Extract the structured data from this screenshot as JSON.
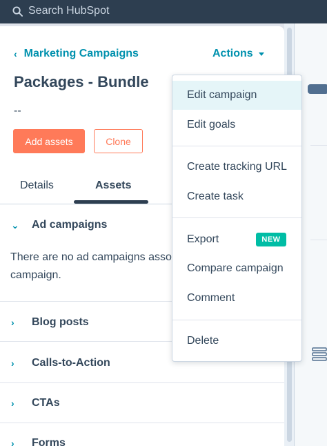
{
  "search": {
    "placeholder": "Search HubSpot",
    "icon": "search-icon"
  },
  "breadcrumb": {
    "label": "Marketing Campaigns"
  },
  "header": {
    "title": "Packages - Bundle",
    "subtitle": "--",
    "actions_label": "Actions"
  },
  "buttons": {
    "add_assets": "Add assets",
    "clone": "Clone"
  },
  "tabs": [
    {
      "label": "Details",
      "active": false
    },
    {
      "label": "Assets",
      "active": true
    }
  ],
  "sections": [
    {
      "label": "Ad campaigns",
      "expanded": true,
      "empty_text_line1": "There are no ad campaigns assoc",
      "empty_text_line2": "campaign."
    },
    {
      "label": "Blog posts",
      "expanded": false
    },
    {
      "label": "Calls-to-Action",
      "expanded": false
    },
    {
      "label": "CTAs",
      "expanded": false
    },
    {
      "label": "Forms",
      "expanded": false
    }
  ],
  "actions_menu": {
    "groups": [
      [
        {
          "label": "Edit campaign",
          "highlighted": true
        },
        {
          "label": "Edit goals"
        }
      ],
      [
        {
          "label": "Create tracking URL"
        },
        {
          "label": "Create task"
        }
      ],
      [
        {
          "label": "Export",
          "badge": "NEW"
        },
        {
          "label": "Compare campaign"
        },
        {
          "label": "Comment"
        }
      ],
      [
        {
          "label": "Delete"
        }
      ]
    ]
  },
  "colors": {
    "topbar": "#2d3e50",
    "link": "#0091ae",
    "primary": "#ff7a59",
    "badge": "#00bda5",
    "text": "#33475b",
    "highlight": "#e5f5f8"
  }
}
